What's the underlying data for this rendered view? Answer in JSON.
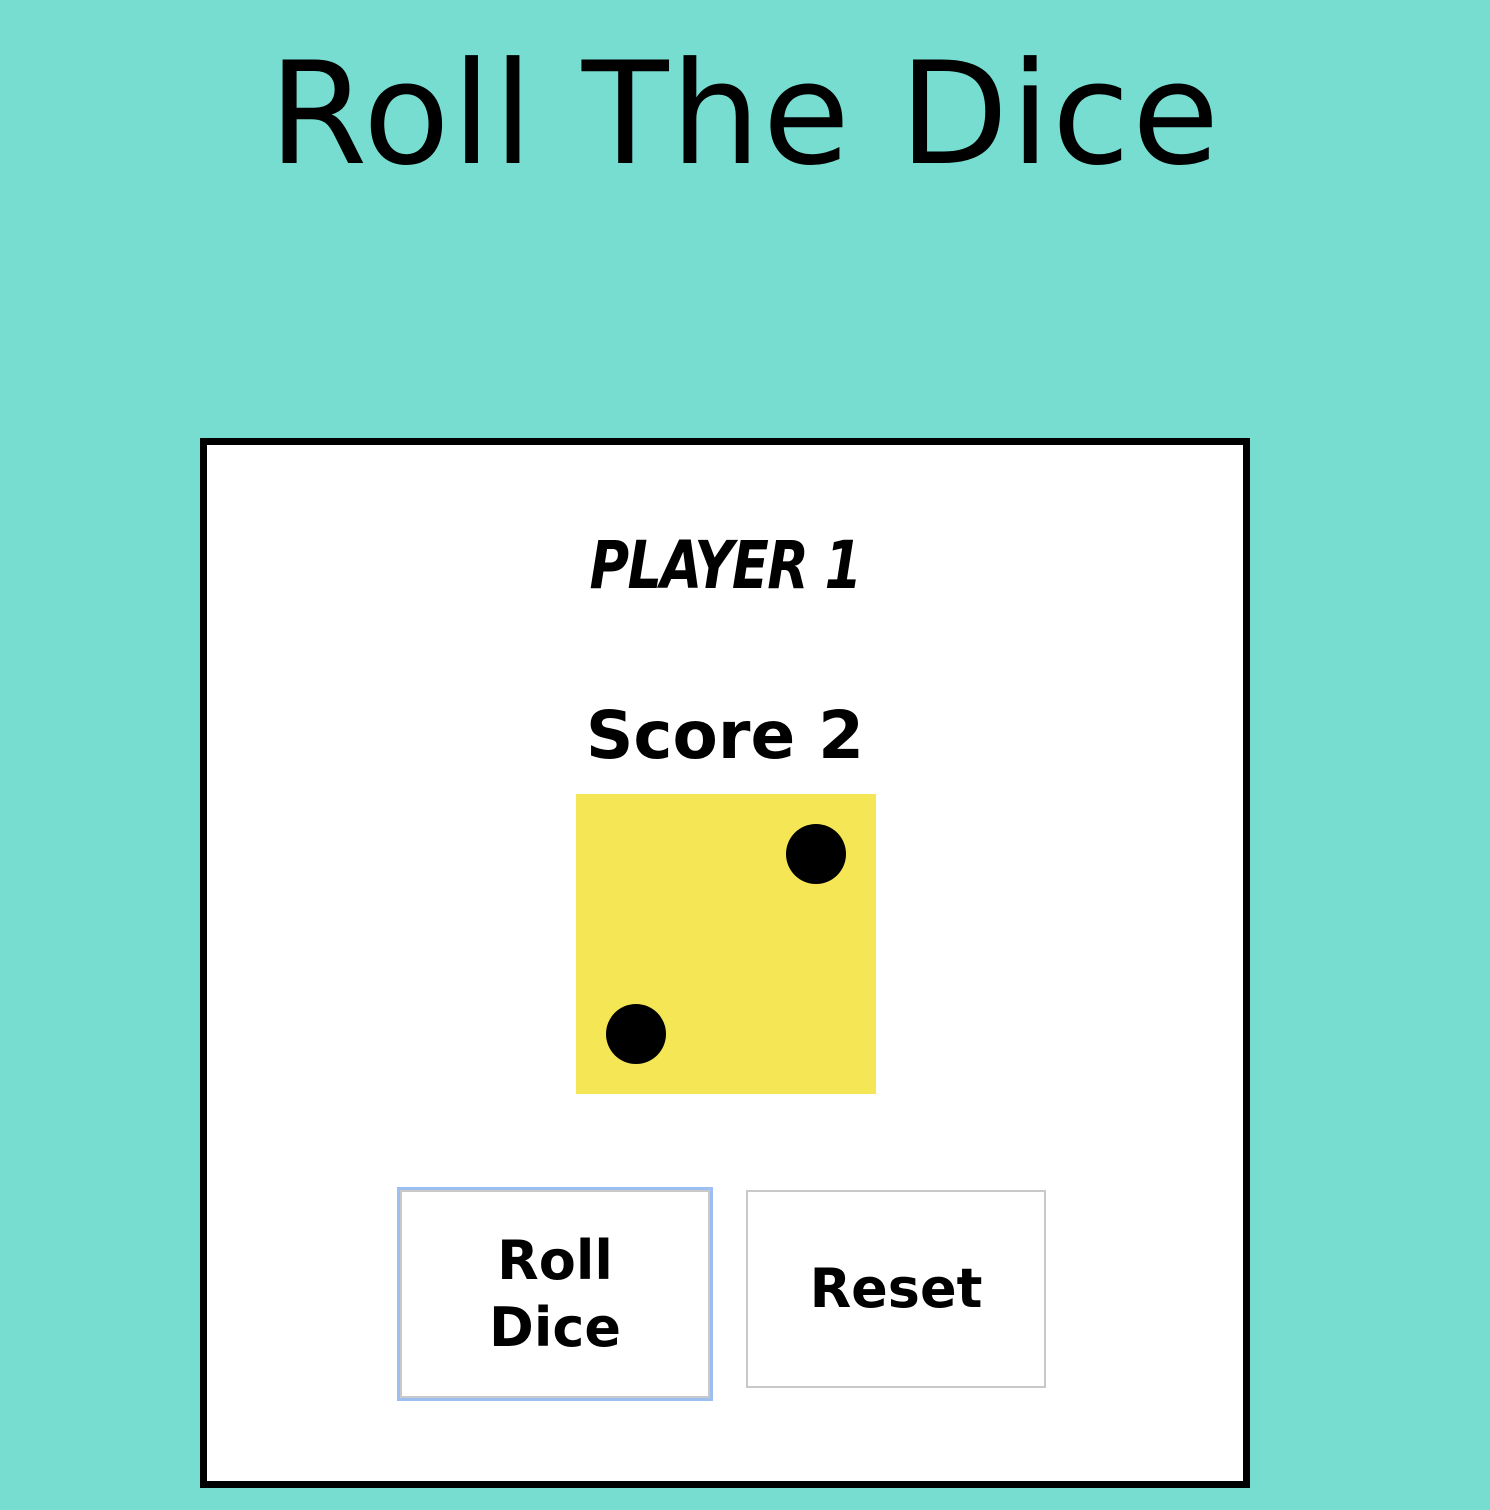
{
  "title": "Roll The Dice",
  "player": {
    "label": "PLAYER 1"
  },
  "score": {
    "label": "Score 2",
    "value": 2
  },
  "die": {
    "face_value": 2,
    "color": "#f5e656",
    "pip_color": "#000000"
  },
  "buttons": {
    "roll_label": "Roll Dice",
    "reset_label": "Reset"
  },
  "colors": {
    "background": "#76ddd0",
    "card": "#ffffff",
    "card_border": "#000000",
    "focus_ring": "#9cbef0"
  }
}
